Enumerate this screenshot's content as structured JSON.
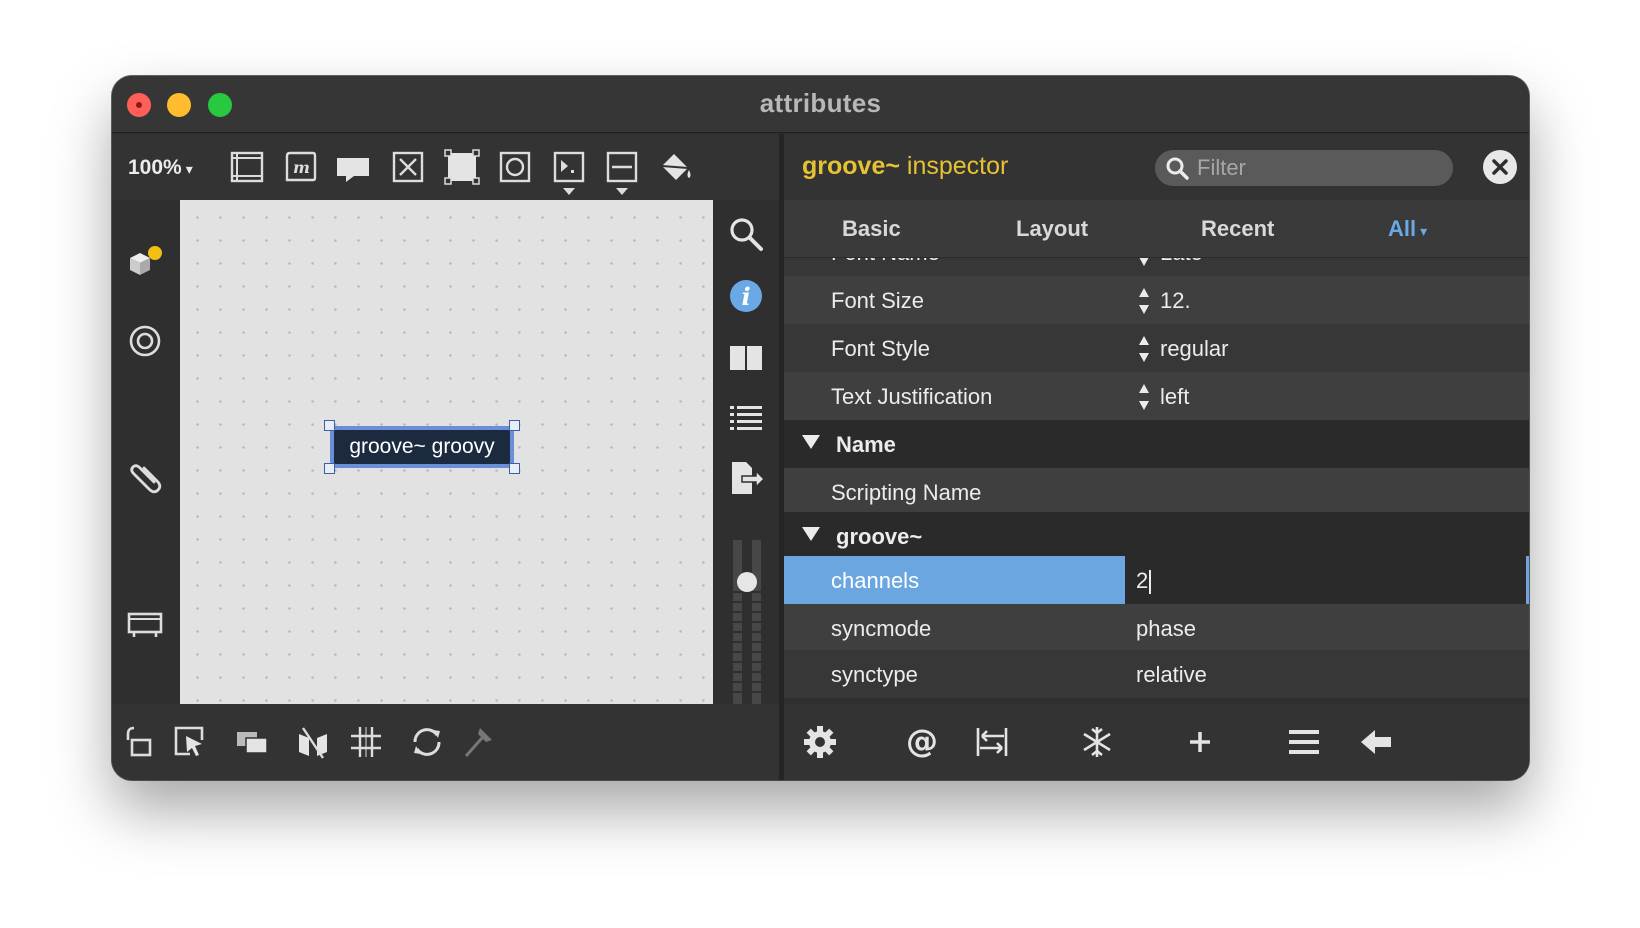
{
  "window": {
    "title": "attributes"
  },
  "toolbar": {
    "zoom_label": "100%",
    "zoom_caret": "▾",
    "icons": [
      "panel-icon",
      "message-box-icon",
      "comment-icon",
      "toggle-icon",
      "presentation-icon",
      "button-icon",
      "number-icon",
      "slider-icon",
      "paint-bucket-icon"
    ]
  },
  "canvas": {
    "object_text": "groove~ groovy"
  },
  "inspector": {
    "title_bold": "groove~",
    "title_rest": " inspector",
    "filter_placeholder": "Filter",
    "tabs": [
      "Basic",
      "Layout",
      "Recent",
      "All"
    ],
    "all_caret": "▾",
    "rows": [
      {
        "label": "Font Name",
        "value": "Lato",
        "stepper": true,
        "partial": true
      },
      {
        "label": "Font Size",
        "value": "12.",
        "stepper": true
      },
      {
        "label": "Font Style",
        "value": "regular",
        "stepper": true
      },
      {
        "label": "Text Justification",
        "value": "left",
        "stepper": true
      },
      {
        "section": "Name"
      },
      {
        "label": "Scripting Name",
        "value": ""
      },
      {
        "section": "groove~"
      },
      {
        "label": "channels",
        "value": "2",
        "selected": true
      },
      {
        "label": "syncmode",
        "value": "phase"
      },
      {
        "label": "synctype",
        "value": "relative"
      }
    ]
  },
  "colors": {
    "accent_blue": "#6ba6e0",
    "title_yellow": "#e6c233",
    "tab_active": "#6aa9e6"
  }
}
